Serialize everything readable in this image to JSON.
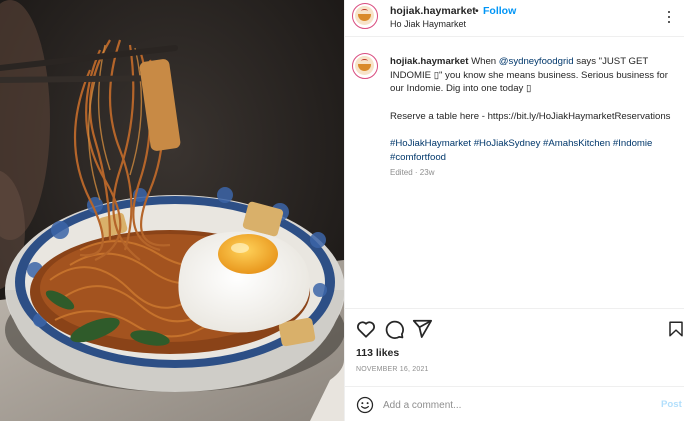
{
  "post": {
    "username": "hojiak.haymarket",
    "separator": "•",
    "follow_label": "Follow",
    "location": "Ho Jiak Haymarket",
    "more_icon": "more-options-icon",
    "avatar_icon": "noodle-bowl-logo"
  },
  "caption": {
    "username": "hojiak.haymarket",
    "text_before_mention": "When",
    "mention": "@sydneyfoodgrid",
    "text_after_mention": "says \"JUST GET INDOMIE ▯\" you know she means business. Serious business for our Indomie. Dig into one today ▯",
    "reserve_text": "Reserve a table here - https://bit.ly/HoJiakHaymarketReservations",
    "hashtags": "#HoJiakHaymarket #HoJiakSydney #AmahsKitchen #Indomie #comfortfood",
    "edited": "Edited · 23w"
  },
  "actions": {
    "like_icon": "heart-icon",
    "comment_icon": "comment-icon",
    "share_icon": "share-icon",
    "save_icon": "bookmark-icon"
  },
  "likes": "113 likes",
  "date": "NOVEMBER 16, 2021",
  "comment": {
    "placeholder": "Add a comment...",
    "post_label": "Post",
    "emoji_icon": "emoji-icon"
  },
  "colors": {
    "link_blue": "#0095f6",
    "mention_blue": "#00376b",
    "border": "#efefef",
    "muted": "#8e8e8e"
  }
}
